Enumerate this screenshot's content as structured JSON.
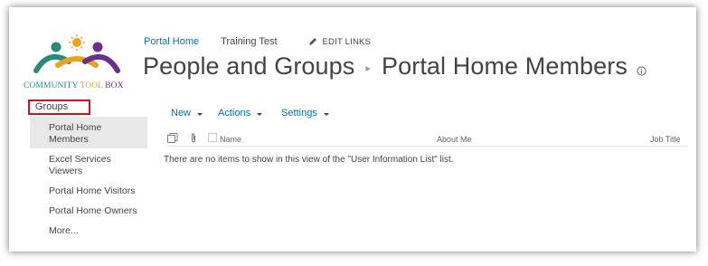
{
  "logo": {
    "word1": "COMMUNITY",
    "word2": "TOOL",
    "word3": "BOX",
    "colors": {
      "teal": "#2a8a7a",
      "orange": "#e8a21c",
      "purple": "#6a2f8a",
      "sun": "#f0a020"
    }
  },
  "topnav": {
    "portal_home": "Portal Home",
    "training_test": "Training Test",
    "edit_links": "EDIT LINKS"
  },
  "title": {
    "part1": "People and Groups",
    "separator": "▸",
    "part2": "Portal Home Members"
  },
  "leftnav": {
    "groups": "Groups",
    "items": [
      {
        "label_line1": "Portal Home",
        "label_line2": "Members"
      },
      {
        "label_line1": "Excel Services",
        "label_line2": "Viewers"
      },
      {
        "label_line1": "Portal Home Visitors"
      },
      {
        "label_line1": "Portal Home Owners"
      },
      {
        "label_line1": "More..."
      }
    ]
  },
  "toolbar": {
    "new": "New",
    "actions": "Actions",
    "settings": "Settings"
  },
  "list": {
    "columns": {
      "name": "Name",
      "about": "About Me",
      "job": "Job Title"
    },
    "empty_message": "There are no items to show in this view of the \"User Information List\" list."
  },
  "colors": {
    "link": "#0072c6",
    "highlight_border": "#d4101f",
    "active_bg": "#e8e8e8"
  }
}
